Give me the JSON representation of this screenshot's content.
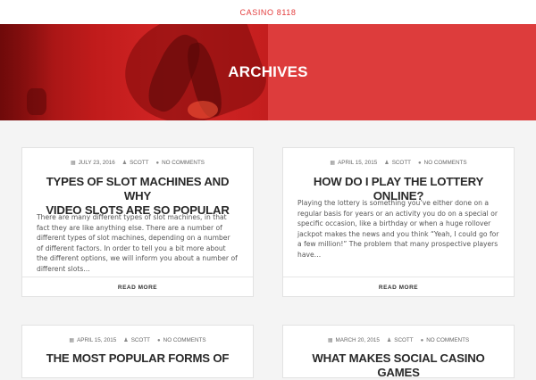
{
  "site": {
    "title": "CASINO 8118"
  },
  "hero": {
    "title": "ARCHIVES"
  },
  "posts": [
    {
      "date": "JULY 23, 2016",
      "author": "SCOTT",
      "comments": "NO COMMENTS",
      "title_line1": "TYPES OF SLOT MACHINES AND WHY",
      "title_line2": "VIDEO SLOTS ARE SO POPULAR",
      "excerpt": "There are many different types of slot machines, in that fact they are like anything else. There are a number of different types of slot machines, depending on a number of different factors. In order to tell you a bit more about the different options, we will inform you about a number of different slots…",
      "read_more": "READ MORE"
    },
    {
      "date": "APRIL 15, 2015",
      "author": "SCOTT",
      "comments": "NO COMMENTS",
      "title_line1": "HOW DO I PLAY THE LOTTERY ONLINE?",
      "title_line2": "",
      "excerpt": "Playing the lottery is something you’ve either done on a regular basis for years or an activity you do on a special or specific occasion, like a birthday or when a huge rollover jackpot makes the news and you think “Yeah, I could go for a few million!” The problem that many prospective players have…",
      "read_more": "READ MORE"
    },
    {
      "date": "APRIL 15, 2015",
      "author": "SCOTT",
      "comments": "NO COMMENTS",
      "title_line1": "THE MOST POPULAR FORMS OF",
      "title_line2": ""
    },
    {
      "date": "MARCH 20, 2015",
      "author": "SCOTT",
      "comments": "NO COMMENTS",
      "title_line1": "WHAT MAKES SOCIAL CASINO GAMES",
      "title_line2": ""
    }
  ]
}
